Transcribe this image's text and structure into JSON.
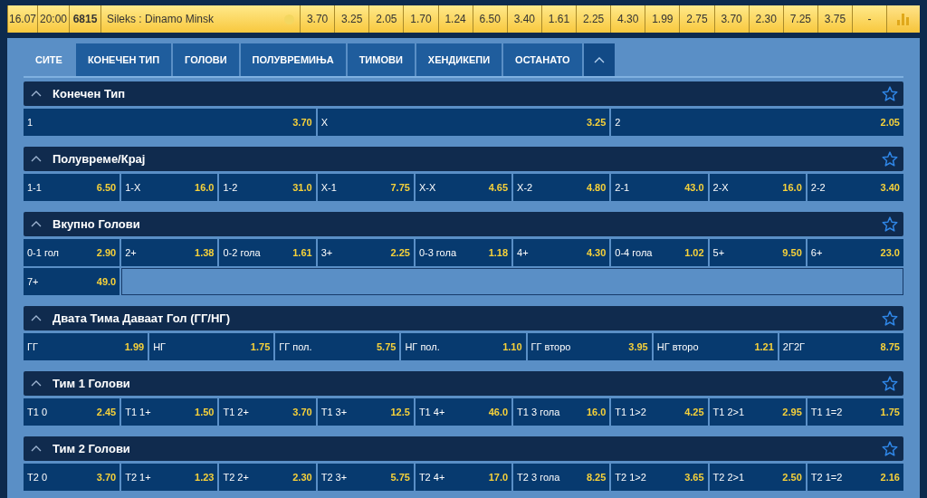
{
  "match": {
    "date": "16.07",
    "time": "20:00",
    "code": "6815",
    "teams": "Sileks : Dinamo Minsk",
    "odds": [
      "3.70",
      "3.25",
      "2.05",
      "1.70",
      "1.24",
      "6.50",
      "3.40",
      "1.61",
      "2.25",
      "4.30",
      "1.99",
      "2.75",
      "3.70",
      "2.30",
      "7.25",
      "3.75",
      "-"
    ]
  },
  "tabs": [
    {
      "label": "СИТЕ",
      "selected": true
    },
    {
      "label": "КОНЕЧЕН ТИП",
      "selected": false
    },
    {
      "label": "ГОЛОВИ",
      "selected": false
    },
    {
      "label": "ПОЛУВРЕМИЊА",
      "selected": false
    },
    {
      "label": "ТИМОВИ",
      "selected": false
    },
    {
      "label": "ХЕНДИКЕПИ",
      "selected": false
    },
    {
      "label": "ОСТАНАТО",
      "selected": false
    }
  ],
  "markets": [
    {
      "title": "Конечен Тип",
      "outcomes": [
        {
          "label": "1",
          "odd": "3.70"
        },
        {
          "label": "X",
          "odd": "3.25"
        },
        {
          "label": "2",
          "odd": "2.05"
        }
      ]
    },
    {
      "title": "Полувреме/Крај",
      "outcomes": [
        {
          "label": "1-1",
          "odd": "6.50"
        },
        {
          "label": "1-X",
          "odd": "16.0"
        },
        {
          "label": "1-2",
          "odd": "31.0"
        },
        {
          "label": "X-1",
          "odd": "7.75"
        },
        {
          "label": "X-X",
          "odd": "4.65"
        },
        {
          "label": "X-2",
          "odd": "4.80"
        },
        {
          "label": "2-1",
          "odd": "43.0"
        },
        {
          "label": "2-X",
          "odd": "16.0"
        },
        {
          "label": "2-2",
          "odd": "3.40"
        }
      ]
    },
    {
      "title": "Вкупно Голови",
      "outcomes": [
        {
          "label": "0-1 гол",
          "odd": "2.90"
        },
        {
          "label": "2+",
          "odd": "1.38"
        },
        {
          "label": "0-2 гола",
          "odd": "1.61"
        },
        {
          "label": "3+",
          "odd": "2.25"
        },
        {
          "label": "0-3 гола",
          "odd": "1.18"
        },
        {
          "label": "4+",
          "odd": "4.30"
        },
        {
          "label": "0-4 гола",
          "odd": "1.02"
        },
        {
          "label": "5+",
          "odd": "9.50"
        },
        {
          "label": "6+",
          "odd": "23.0"
        },
        {
          "label": "7+",
          "odd": "49.0"
        }
      ]
    },
    {
      "title": "Двата Тима Даваат Гол (ГГ/НГ)",
      "outcomes": [
        {
          "label": "ГГ",
          "odd": "1.99"
        },
        {
          "label": "НГ",
          "odd": "1.75"
        },
        {
          "label": "ГГ пол.",
          "odd": "5.75"
        },
        {
          "label": "НГ пол.",
          "odd": "1.10"
        },
        {
          "label": "ГГ второ",
          "odd": "3.95"
        },
        {
          "label": "НГ второ",
          "odd": "1.21"
        },
        {
          "label": "2Г2Г",
          "odd": "8.75"
        }
      ]
    },
    {
      "title": "Тим 1 Голови",
      "outcomes": [
        {
          "label": "Т1 0",
          "odd": "2.45"
        },
        {
          "label": "Т1 1+",
          "odd": "1.50"
        },
        {
          "label": "Т1 2+",
          "odd": "3.70"
        },
        {
          "label": "Т1 3+",
          "odd": "12.5"
        },
        {
          "label": "Т1 4+",
          "odd": "46.0"
        },
        {
          "label": "Т1 3 гола",
          "odd": "16.0"
        },
        {
          "label": "Т1 1>2",
          "odd": "4.25"
        },
        {
          "label": "Т1 2>1",
          "odd": "2.95"
        },
        {
          "label": "Т1 1=2",
          "odd": "1.75"
        }
      ]
    },
    {
      "title": "Тим 2 Голови",
      "outcomes": [
        {
          "label": "Т2 0",
          "odd": "3.70"
        },
        {
          "label": "Т2 1+",
          "odd": "1.23"
        },
        {
          "label": "Т2 2+",
          "odd": "2.30"
        },
        {
          "label": "Т2 3+",
          "odd": "5.75"
        },
        {
          "label": "Т2 4+",
          "odd": "17.0"
        },
        {
          "label": "Т2 3 гола",
          "odd": "8.25"
        },
        {
          "label": "Т2 1>2",
          "odd": "3.65"
        },
        {
          "label": "Т2 2>1",
          "odd": "2.50"
        },
        {
          "label": "Т2 1=2",
          "odd": "2.16"
        }
      ]
    }
  ]
}
